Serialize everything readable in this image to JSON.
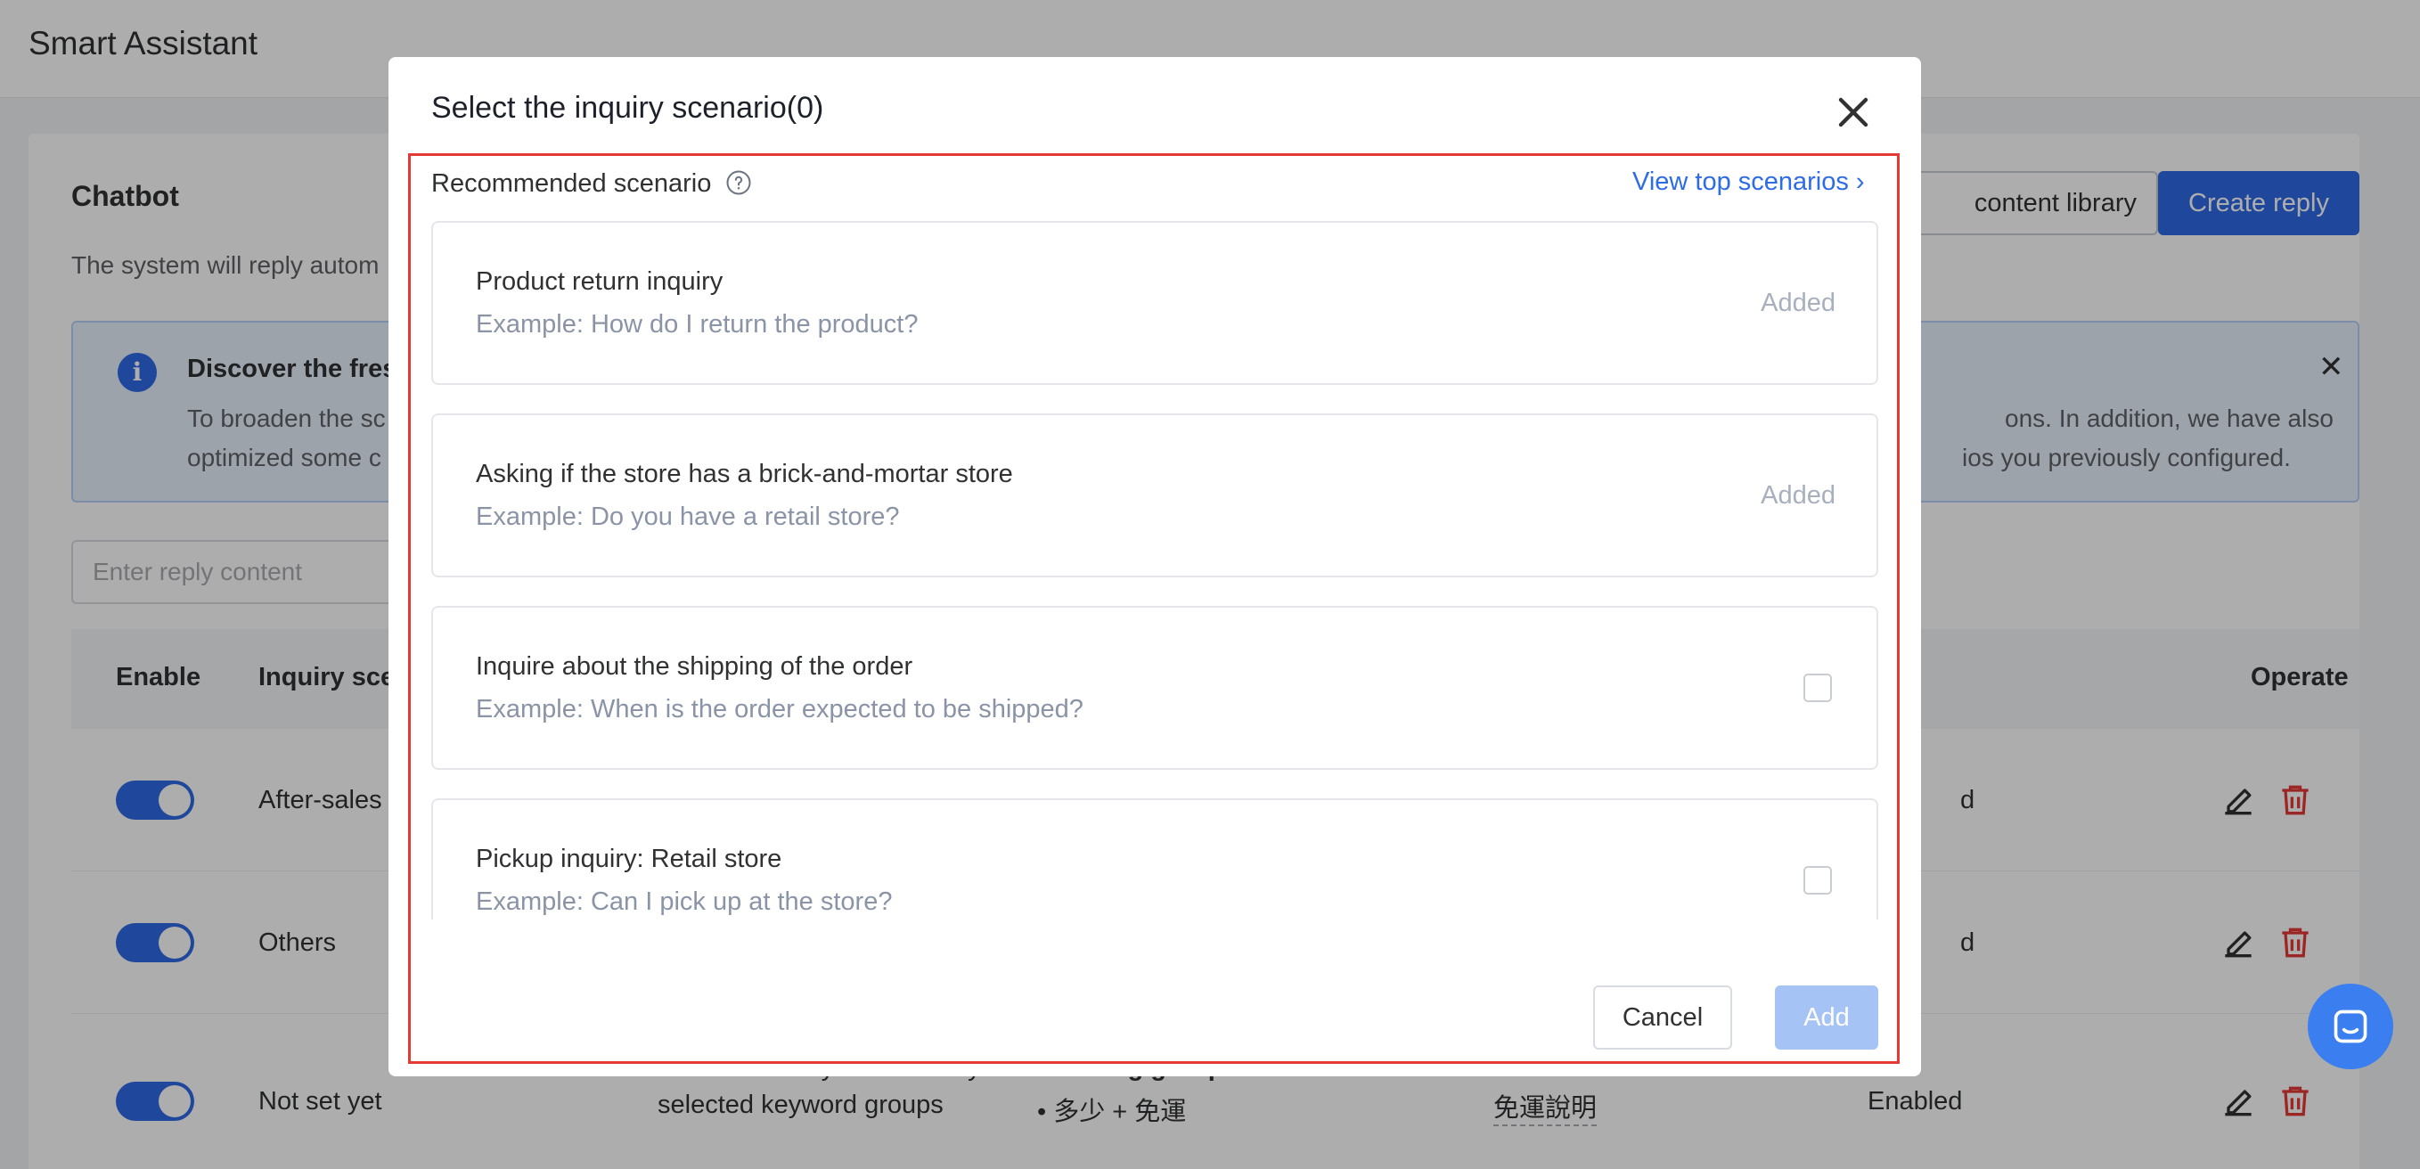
{
  "app": {
    "title": "Smart Assistant"
  },
  "panel": {
    "title": "Chatbot",
    "description": "The system will reply autom",
    "library_button": "content library",
    "create_button": "Create reply"
  },
  "notice": {
    "title": "Discover the fres",
    "line1_left": "To broaden the sc",
    "line2_left": "optimized some c",
    "line1_right": "ons. In addition, we have also",
    "line2_right": "ios you previously configured."
  },
  "search": {
    "placeholder": "Enter reply content"
  },
  "table": {
    "headers": {
      "enable": "Enable",
      "scenario": "Inquiry sce",
      "operate": "Operate"
    },
    "rows": [
      {
        "scenario": "After-sales",
        "status_partial": "d"
      },
      {
        "scenario": "Others",
        "status_partial": "d"
      },
      {
        "scenario": "Not set yet",
        "keyword_rule_1": "Includes all keywords of any",
        "keyword_rule_2": "selected keyword groups",
        "groups_label": "following groups:",
        "group_item": "• 多少 + 免運",
        "reply": "免運說明",
        "status": "Enabled"
      }
    ]
  },
  "modal": {
    "title": "Select the inquiry scenario(0)",
    "section_label": "Recommended scenario",
    "top_link": "View top scenarios ›",
    "scenarios": [
      {
        "title": "Product return inquiry",
        "example": "Example: How do I return the product?",
        "status": "Added"
      },
      {
        "title": "Asking if the store has a brick-and-mortar store",
        "example": "Example: Do you have a retail store?",
        "status": "Added"
      },
      {
        "title": "Inquire about the shipping of the order",
        "example": "Example: When is the order expected to be shipped?",
        "status": ""
      },
      {
        "title": "Pickup inquiry: Retail store",
        "example": "Example: Can I pick up at the store?",
        "status": ""
      }
    ],
    "cancel_label": "Cancel",
    "add_label": "Add"
  },
  "colors": {
    "accent": "#2e6be6",
    "highlight_border": "#e53935",
    "disabled_button": "#a6c3f5",
    "delete_icon": "#e53935"
  },
  "icons": [
    "info-icon",
    "close-icon",
    "help-icon",
    "edit-icon",
    "delete-icon",
    "chat-icon",
    "chevron-right-icon"
  ]
}
